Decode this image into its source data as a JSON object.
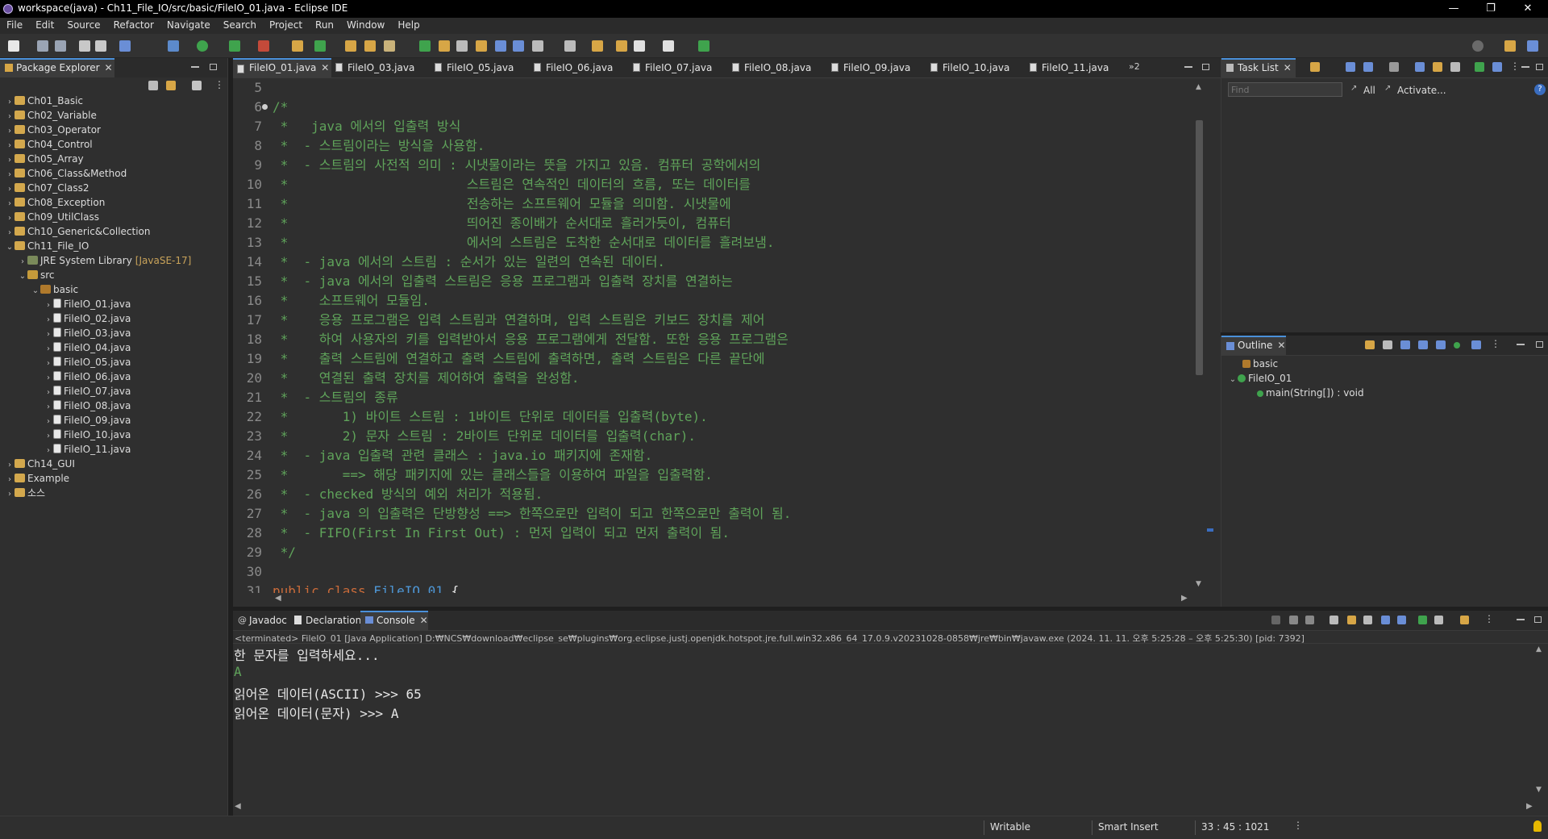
{
  "window": {
    "title": "workspace(java) - Ch11_File_IO/src/basic/FileIO_01.java - Eclipse IDE",
    "minimize": "—",
    "restore": "❐",
    "close": "✕"
  },
  "menu": [
    "File",
    "Edit",
    "Source",
    "Refactor",
    "Navigate",
    "Search",
    "Project",
    "Run",
    "Window",
    "Help"
  ],
  "package_explorer": {
    "title": "Package Explorer",
    "items": [
      {
        "label": "Ch01_Basic",
        "depth": 0,
        "arrow": "›",
        "icon": "proj"
      },
      {
        "label": "Ch02_Variable",
        "depth": 0,
        "arrow": "›",
        "icon": "proj"
      },
      {
        "label": "Ch03_Operator",
        "depth": 0,
        "arrow": "›",
        "icon": "proj"
      },
      {
        "label": "Ch04_Control",
        "depth": 0,
        "arrow": "›",
        "icon": "proj"
      },
      {
        "label": "Ch05_Array",
        "depth": 0,
        "arrow": "›",
        "icon": "proj"
      },
      {
        "label": "Ch06_Class&Method",
        "depth": 0,
        "arrow": "›",
        "icon": "proj"
      },
      {
        "label": "Ch07_Class2",
        "depth": 0,
        "arrow": "›",
        "icon": "proj"
      },
      {
        "label": "Ch08_Exception",
        "depth": 0,
        "arrow": "›",
        "icon": "proj"
      },
      {
        "label": "Ch09_UtilClass",
        "depth": 0,
        "arrow": "›",
        "icon": "proj"
      },
      {
        "label": "Ch10_Generic&Collection",
        "depth": 0,
        "arrow": "›",
        "icon": "proj"
      },
      {
        "label": "Ch11_File_IO",
        "depth": 0,
        "arrow": "⌄",
        "icon": "proj"
      },
      {
        "label": "JRE System Library",
        "suffix": "[JavaSE-17]",
        "depth": 1,
        "arrow": "›",
        "icon": "lib"
      },
      {
        "label": "src",
        "depth": 1,
        "arrow": "⌄",
        "icon": "srcf"
      },
      {
        "label": "basic",
        "depth": 2,
        "arrow": "⌄",
        "icon": "pkg"
      },
      {
        "label": "FileIO_01.java",
        "depth": 3,
        "arrow": "›",
        "icon": "jfile"
      },
      {
        "label": "FileIO_02.java",
        "depth": 3,
        "arrow": "›",
        "icon": "jfile"
      },
      {
        "label": "FileIO_03.java",
        "depth": 3,
        "arrow": "›",
        "icon": "jfile"
      },
      {
        "label": "FileIO_04.java",
        "depth": 3,
        "arrow": "›",
        "icon": "jfile"
      },
      {
        "label": "FileIO_05.java",
        "depth": 3,
        "arrow": "›",
        "icon": "jfile"
      },
      {
        "label": "FileIO_06.java",
        "depth": 3,
        "arrow": "›",
        "icon": "jfile"
      },
      {
        "label": "FileIO_07.java",
        "depth": 3,
        "arrow": "›",
        "icon": "jfile"
      },
      {
        "label": "FileIO_08.java",
        "depth": 3,
        "arrow": "›",
        "icon": "jfile"
      },
      {
        "label": "FileIO_09.java",
        "depth": 3,
        "arrow": "›",
        "icon": "jfile"
      },
      {
        "label": "FileIO_10.java",
        "depth": 3,
        "arrow": "›",
        "icon": "jfile"
      },
      {
        "label": "FileIO_11.java",
        "depth": 3,
        "arrow": "›",
        "icon": "jfile"
      },
      {
        "label": "Ch14_GUI",
        "depth": 0,
        "arrow": "›",
        "icon": "proj"
      },
      {
        "label": "Example",
        "depth": 0,
        "arrow": "›",
        "icon": "proj"
      },
      {
        "label": "소스",
        "depth": 0,
        "arrow": "›",
        "icon": "proj"
      }
    ]
  },
  "editor": {
    "tabs": [
      "FileIO_01.java",
      "FileIO_03.java",
      "FileIO_05.java",
      "FileIO_06.java",
      "FileIO_07.java",
      "FileIO_08.java",
      "FileIO_09.java",
      "FileIO_10.java",
      "FileIO_11.java"
    ],
    "overflow": "»2",
    "lines": [
      {
        "n": "5",
        "t": ""
      },
      {
        "n": "6",
        "t": "/*",
        "fold": true
      },
      {
        "n": "7",
        "t": " *   java 에서의 입출력 방식"
      },
      {
        "n": "8",
        "t": " *  - 스트림이라는 방식을 사용함."
      },
      {
        "n": "9",
        "t": " *  - 스트림의 사전적 의미 : 시냇물이라는 뜻을 가지고 있음. 컴퓨터 공학에서의"
      },
      {
        "n": "10",
        "t": " *                       스트림은 연속적인 데이터의 흐름, 또는 데이터를"
      },
      {
        "n": "11",
        "t": " *                       전송하는 소프트웨어 모듈을 의미함. 시냇물에"
      },
      {
        "n": "12",
        "t": " *                       띄어진 종이배가 순서대로 흘러가듯이, 컴퓨터"
      },
      {
        "n": "13",
        "t": " *                       에서의 스트림은 도착한 순서대로 데이터를 흘려보냄."
      },
      {
        "n": "14",
        "t": " *  - java 에서의 스트림 : 순서가 있는 일련의 연속된 데이터."
      },
      {
        "n": "15",
        "t": " *  - java 에서의 입출력 스트림은 응용 프로그램과 입출력 장치를 연결하는"
      },
      {
        "n": "16",
        "t": " *    소프트웨어 모듈임."
      },
      {
        "n": "17",
        "t": " *    응용 프로그램은 입력 스트림과 연결하며, 입력 스트림은 키보드 장치를 제어"
      },
      {
        "n": "18",
        "t": " *    하여 사용자의 키를 입력받아서 응용 프로그램에게 전달함. 또한 응용 프로그램은"
      },
      {
        "n": "19",
        "t": " *    출력 스트림에 연결하고 출력 스트림에 출력하면, 출력 스트림은 다른 끝단에"
      },
      {
        "n": "20",
        "t": " *    연결된 출력 장치를 제어하여 출력을 완성함."
      },
      {
        "n": "21",
        "t": " *  - 스트림의 종류"
      },
      {
        "n": "22",
        "t": " *       1) 바이트 스트림 : 1바이트 단위로 데이터를 입출력(byte)."
      },
      {
        "n": "23",
        "t": " *       2) 문자 스트림 : 2바이트 단위로 데이터를 입출력(char)."
      },
      {
        "n": "24",
        "t": " *  - java 입출력 관련 클래스 : java.io 패키지에 존재함."
      },
      {
        "n": "25",
        "t": " *       ==> 해당 패키지에 있는 클래스들을 이용하여 파일을 입출력함."
      },
      {
        "n": "26",
        "t": " *  - checked 방식의 예외 처리가 적용됨."
      },
      {
        "n": "27",
        "t": " *  - java 의 입출력은 단방향성 ==> 한쪽으로만 입력이 되고 한쪽으로만 출력이 됨."
      },
      {
        "n": "28",
        "t": " *  - FIFO(First In First Out) : 먼저 입력이 되고 먼저 출력이 됨."
      },
      {
        "n": "29",
        "t": " */"
      },
      {
        "n": "30",
        "t": ""
      }
    ],
    "last_line": {
      "n": "31",
      "kw": "public class ",
      "cls": "FileIO_01",
      "rest": " {"
    }
  },
  "task_list": {
    "title": "Task List",
    "find_placeholder": "Find",
    "all": "All",
    "activate": "Activate..."
  },
  "outline": {
    "title": "Outline",
    "package": "basic",
    "class": "FileIO_01",
    "method": "main(String[]) : void"
  },
  "bottom_tabs": {
    "javadoc": "Javadoc",
    "declaration": "Declaration",
    "console": "Console"
  },
  "console": {
    "header": "<terminated> FileIO_01 [Java Application] D:₩NCS₩download₩eclipse_se₩plugins₩org.eclipse.justj.openjdk.hotspot.jre.full.win32.x86_64_17.0.9.v20231028-0858₩jre₩bin₩javaw.exe  (2024. 11. 11. 오후 5:25:28 – 오후 5:25:30) [pid: 7392]",
    "lines": [
      {
        "t": "한 문자를 입력하세요...",
        "color": "#e6e6e6"
      },
      {
        "t": "A",
        "color": "#5fa35a"
      },
      {
        "t": "읽어온 데이터(ASCII) >>> 65",
        "color": "#e6e6e6"
      },
      {
        "t": "읽어온 데이터(문자) >>> A",
        "color": "#e6e6e6"
      }
    ]
  },
  "status": {
    "writable": "Writable",
    "insert_mode": "Smart Insert",
    "position": "33 : 45 : 1021"
  },
  "colors": {
    "accent": "#4a90d9",
    "comment": "#5fa35a",
    "keyword": "#cc6c3a",
    "class": "#4e97d6"
  }
}
